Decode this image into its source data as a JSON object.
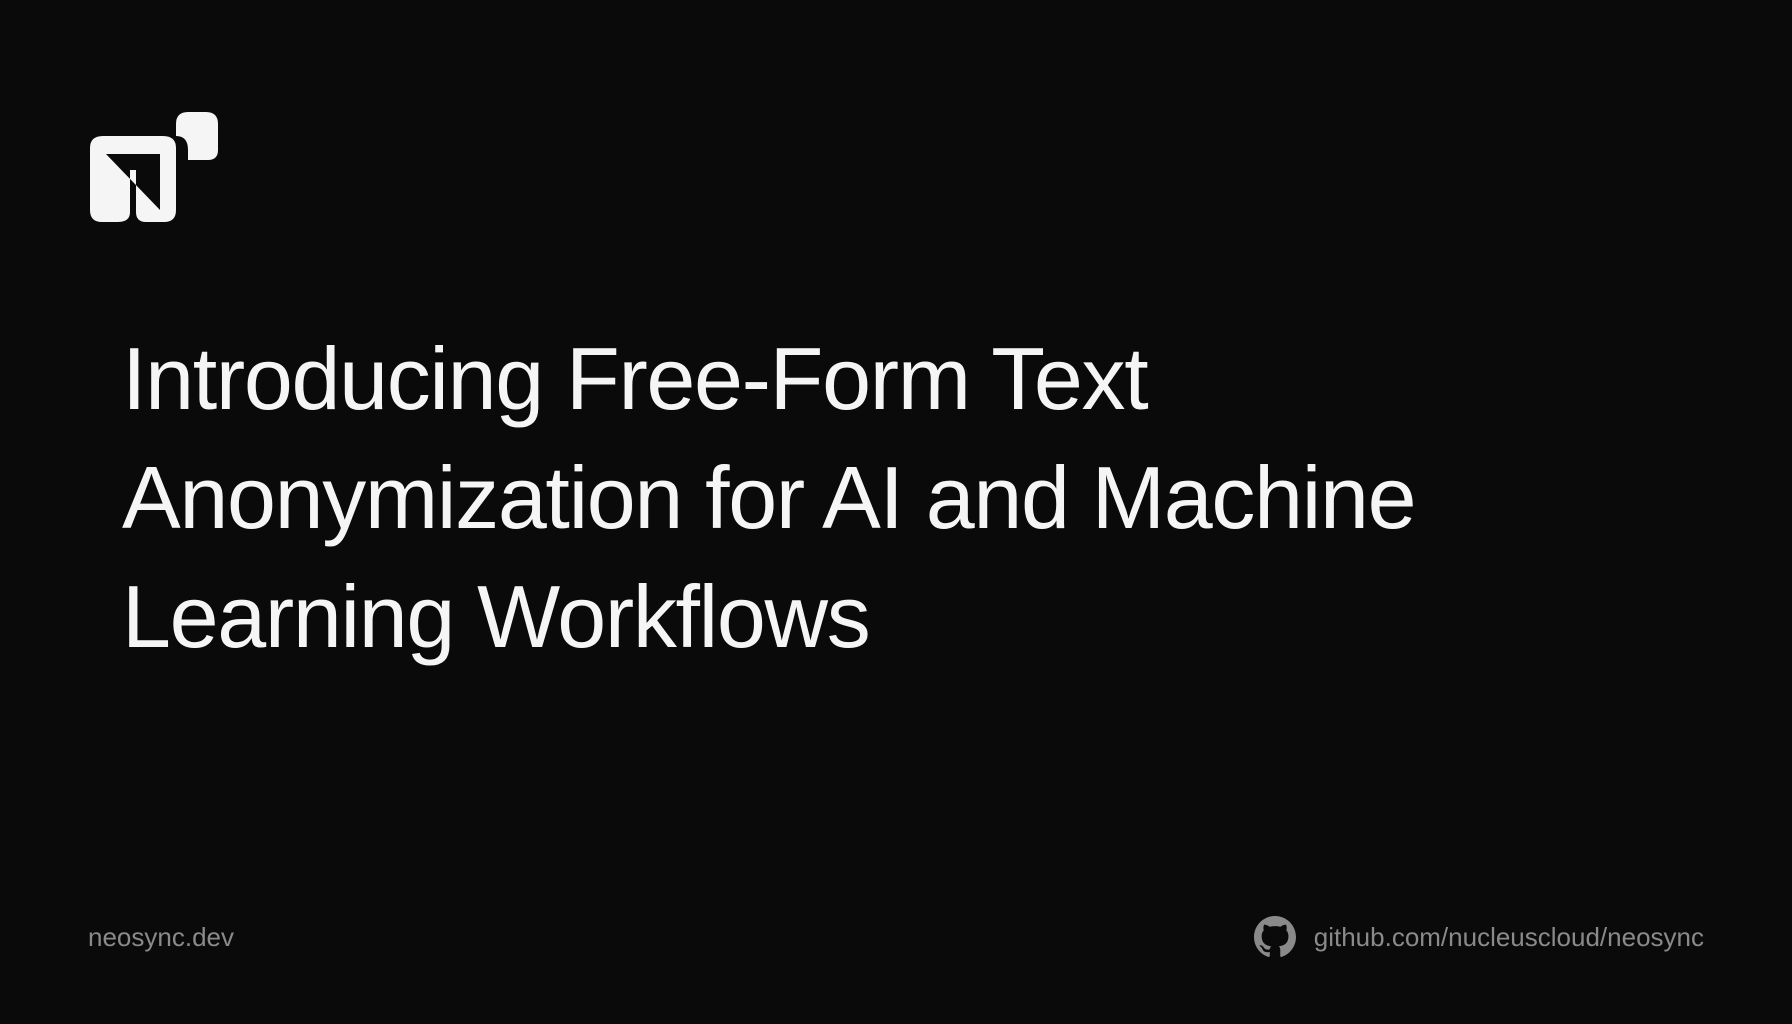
{
  "title": "Introducing Free-Form Text Anonymization for AI and Machine Learning Workflows",
  "footer": {
    "site_url": "neosync.dev",
    "github_url": "github.com/nucleuscloud/neosync"
  }
}
